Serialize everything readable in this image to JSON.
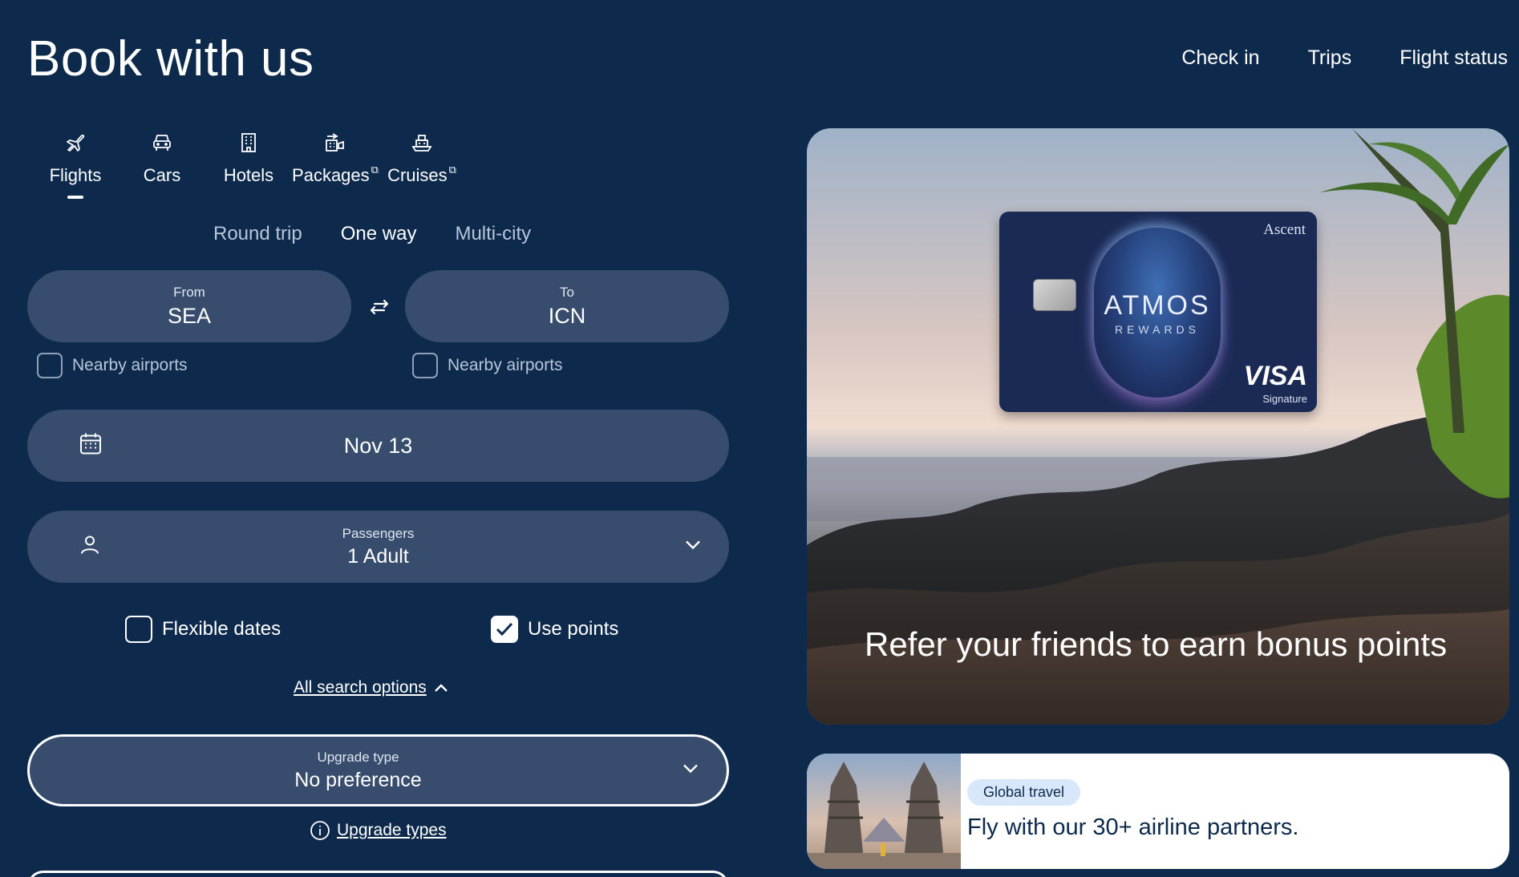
{
  "page_title": "Book with us",
  "top_nav": [
    "Check in",
    "Trips",
    "Flight status"
  ],
  "product_tabs": [
    {
      "label": "Flights",
      "icon": "plane-icon",
      "active": true
    },
    {
      "label": "Cars",
      "icon": "car-icon"
    },
    {
      "label": "Hotels",
      "icon": "hotel-icon"
    },
    {
      "label": "Packages",
      "icon": "packages-icon",
      "external": true
    },
    {
      "label": "Cruises",
      "icon": "ship-icon",
      "external": true
    }
  ],
  "trip_types": [
    "Round trip",
    "One way",
    "Multi-city"
  ],
  "selected_trip_type": "One way",
  "from": {
    "label": "From",
    "value": "SEA"
  },
  "to": {
    "label": "To",
    "value": "ICN"
  },
  "nearby_from": "Nearby airports",
  "nearby_to": "Nearby airports",
  "date": "Nov 13",
  "passengers": {
    "label": "Passengers",
    "value": "1 Adult"
  },
  "flexible_dates": {
    "label": "Flexible dates",
    "checked": false
  },
  "use_points": {
    "label": "Use points",
    "checked": true
  },
  "all_search_options": "All search options",
  "upgrade_type": {
    "label": "Upgrade type",
    "value": "No preference"
  },
  "upgrade_types_link": "Upgrade types",
  "promo_main": {
    "caption": "Refer your friends to earn bonus points",
    "card_brand_top": "Ascent",
    "card_logo": "ATMOS",
    "card_logo_sub": "REWARDS",
    "card_network": "VISA",
    "card_network_sub": "Signature"
  },
  "promo_secondary": {
    "badge": "Global travel",
    "headline": "Fly with our 30+ airline partners."
  },
  "colors": {
    "background": "#0d2a4d",
    "pill": "#384d6e",
    "muted_text": "#b9c6d8"
  }
}
